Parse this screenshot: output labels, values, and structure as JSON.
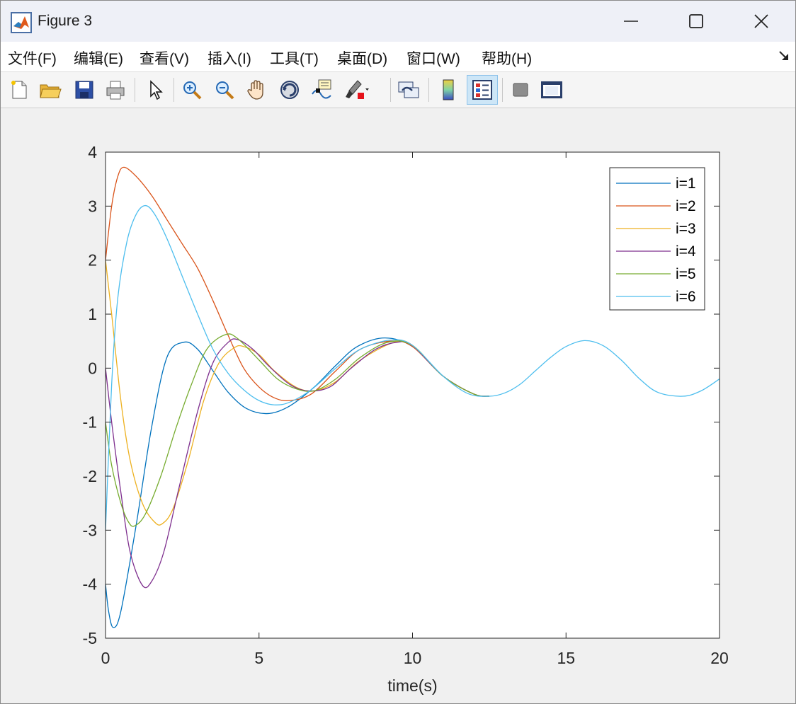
{
  "window": {
    "title": "Figure 3",
    "icon": "matlab-icon",
    "controls": [
      "minimize-icon",
      "maximize-icon",
      "close-icon"
    ]
  },
  "menu": {
    "items": [
      "文件(F)",
      "编辑(E)",
      "查看(V)",
      "插入(I)",
      "工具(T)",
      "桌面(D)",
      "窗口(W)",
      "帮助(H)"
    ]
  },
  "toolbar": {
    "buttons": [
      {
        "icon": "new-figure-icon"
      },
      {
        "icon": "open-file-icon"
      },
      {
        "icon": "save-icon"
      },
      {
        "icon": "print-icon"
      },
      {
        "icon": "edit-plot-arrow-icon"
      },
      {
        "icon": "zoom-in-icon"
      },
      {
        "icon": "zoom-out-icon"
      },
      {
        "icon": "pan-hand-icon"
      },
      {
        "icon": "rotate-3d-icon"
      },
      {
        "icon": "data-cursor-icon"
      },
      {
        "icon": "brush-icon"
      },
      {
        "icon": "link-plot-icon"
      },
      {
        "icon": "colorbar-icon"
      },
      {
        "icon": "legend-icon",
        "active": true
      },
      {
        "icon": "hide-plot-tools-icon"
      },
      {
        "icon": "show-plot-tools-icon"
      }
    ]
  },
  "chart_data": {
    "type": "line",
    "xlabel": "time(s)",
    "ylabel": "",
    "title": "",
    "xlim": [
      0,
      20
    ],
    "ylim": [
      -5,
      4
    ],
    "xticks": [
      "0",
      "5",
      "10",
      "15",
      "20"
    ],
    "yticks": [
      "4",
      "3",
      "2",
      "1",
      "0",
      "-1",
      "-2",
      "-3",
      "-4",
      "-5"
    ],
    "grid": false,
    "legend_position": "top-right",
    "series": [
      {
        "name": "i=1",
        "color": "#0072BD",
        "points": [
          [
            0,
            -4
          ],
          [
            0.1,
            -4.5
          ],
          [
            0.25,
            -4.8
          ],
          [
            0.5,
            -4.5
          ],
          [
            1.0,
            -2.9
          ],
          [
            1.5,
            -1.1
          ],
          [
            2.0,
            0.2
          ],
          [
            2.55,
            0.48
          ],
          [
            3.0,
            0.35
          ],
          [
            3.5,
            -0.05
          ],
          [
            4.0,
            -0.45
          ],
          [
            4.6,
            -0.75
          ],
          [
            5.3,
            -0.84
          ],
          [
            6.0,
            -0.7
          ],
          [
            6.8,
            -0.35
          ],
          [
            7.5,
            0.05
          ],
          [
            8.2,
            0.4
          ],
          [
            9.1,
            0.56
          ],
          [
            10.0,
            0.4
          ],
          [
            11.0,
            -0.15
          ],
          [
            12.0,
            -0.48
          ],
          [
            12.5,
            -0.52
          ]
        ]
      },
      {
        "name": "i=2",
        "color": "#D95319",
        "points": [
          [
            0,
            2
          ],
          [
            0.2,
            3.0
          ],
          [
            0.4,
            3.55
          ],
          [
            0.6,
            3.72
          ],
          [
            1.0,
            3.55
          ],
          [
            1.5,
            3.2
          ],
          [
            2.0,
            2.75
          ],
          [
            2.5,
            2.3
          ],
          [
            3.0,
            1.85
          ],
          [
            3.5,
            1.25
          ],
          [
            4.0,
            0.6
          ],
          [
            4.5,
            0.0
          ],
          [
            5.0,
            -0.35
          ],
          [
            5.5,
            -0.55
          ],
          [
            6.0,
            -0.6
          ],
          [
            6.7,
            -0.48
          ],
          [
            7.5,
            -0.05
          ],
          [
            8.3,
            0.35
          ],
          [
            9.3,
            0.5
          ],
          [
            10.0,
            0.4
          ],
          [
            11.0,
            -0.15
          ],
          [
            12.0,
            -0.48
          ],
          [
            12.5,
            -0.52
          ]
        ]
      },
      {
        "name": "i=3",
        "color": "#EDB120",
        "points": [
          [
            0,
            2
          ],
          [
            0.2,
            1.0
          ],
          [
            0.5,
            -0.6
          ],
          [
            0.8,
            -1.7
          ],
          [
            1.2,
            -2.5
          ],
          [
            1.6,
            -2.85
          ],
          [
            1.85,
            -2.88
          ],
          [
            2.2,
            -2.6
          ],
          [
            2.7,
            -1.7
          ],
          [
            3.2,
            -0.6
          ],
          [
            3.7,
            0.1
          ],
          [
            4.2,
            0.38
          ],
          [
            4.5,
            0.4
          ],
          [
            5.0,
            0.25
          ],
          [
            5.5,
            -0.05
          ],
          [
            6.2,
            -0.35
          ],
          [
            6.8,
            -0.42
          ],
          [
            7.5,
            -0.25
          ],
          [
            8.3,
            0.15
          ],
          [
            9.4,
            0.48
          ],
          [
            10.0,
            0.42
          ],
          [
            11.0,
            -0.15
          ],
          [
            12.0,
            -0.48
          ],
          [
            12.5,
            -0.52
          ]
        ]
      },
      {
        "name": "i=4",
        "color": "#7E2F8E",
        "points": [
          [
            0,
            0
          ],
          [
            0.2,
            -1.0
          ],
          [
            0.5,
            -2.3
          ],
          [
            0.8,
            -3.4
          ],
          [
            1.2,
            -4.02
          ],
          [
            1.5,
            -3.95
          ],
          [
            1.9,
            -3.4
          ],
          [
            2.4,
            -2.2
          ],
          [
            3.0,
            -0.8
          ],
          [
            3.5,
            0.1
          ],
          [
            4.0,
            0.48
          ],
          [
            4.3,
            0.53
          ],
          [
            4.8,
            0.35
          ],
          [
            5.3,
            0.05
          ],
          [
            6.0,
            -0.3
          ],
          [
            6.6,
            -0.42
          ],
          [
            7.3,
            -0.35
          ],
          [
            8.0,
            0.0
          ],
          [
            8.8,
            0.35
          ],
          [
            9.5,
            0.48
          ],
          [
            10.0,
            0.42
          ],
          [
            11.0,
            -0.15
          ],
          [
            12.0,
            -0.48
          ],
          [
            12.5,
            -0.52
          ]
        ]
      },
      {
        "name": "i=5",
        "color": "#77AC30",
        "points": [
          [
            0,
            -1
          ],
          [
            0.2,
            -1.8
          ],
          [
            0.5,
            -2.5
          ],
          [
            0.75,
            -2.85
          ],
          [
            0.95,
            -2.92
          ],
          [
            1.3,
            -2.7
          ],
          [
            1.8,
            -2.0
          ],
          [
            2.3,
            -1.1
          ],
          [
            2.8,
            -0.3
          ],
          [
            3.3,
            0.35
          ],
          [
            3.9,
            0.62
          ],
          [
            4.3,
            0.55
          ],
          [
            5.0,
            0.15
          ],
          [
            5.6,
            -0.2
          ],
          [
            6.2,
            -0.38
          ],
          [
            6.8,
            -0.42
          ],
          [
            7.5,
            -0.2
          ],
          [
            8.3,
            0.2
          ],
          [
            9.2,
            0.48
          ],
          [
            10.0,
            0.42
          ],
          [
            11.0,
            -0.15
          ],
          [
            12.0,
            -0.48
          ],
          [
            12.5,
            -0.52
          ]
        ]
      },
      {
        "name": "i=6",
        "color": "#4DBEEE",
        "points": [
          [
            0,
            -3
          ],
          [
            0.2,
            -0.3
          ],
          [
            0.4,
            1.3
          ],
          [
            0.7,
            2.35
          ],
          [
            1.0,
            2.85
          ],
          [
            1.3,
            3.01
          ],
          [
            1.6,
            2.85
          ],
          [
            2.0,
            2.4
          ],
          [
            2.5,
            1.7
          ],
          [
            3.0,
            1.0
          ],
          [
            3.5,
            0.35
          ],
          [
            4.0,
            -0.1
          ],
          [
            4.5,
            -0.4
          ],
          [
            5.0,
            -0.6
          ],
          [
            5.5,
            -0.68
          ],
          [
            6.0,
            -0.63
          ],
          [
            6.7,
            -0.4
          ],
          [
            7.5,
            0.0
          ],
          [
            8.3,
            0.35
          ],
          [
            9.3,
            0.52
          ],
          [
            10.0,
            0.42
          ],
          [
            11.0,
            -0.15
          ],
          [
            11.8,
            -0.47
          ],
          [
            12.5,
            -0.52
          ],
          [
            13.0,
            -0.46
          ],
          [
            13.5,
            -0.3
          ],
          [
            14.0,
            -0.05
          ],
          [
            14.5,
            0.2
          ],
          [
            15.0,
            0.4
          ],
          [
            15.6,
            0.51
          ],
          [
            16.2,
            0.42
          ],
          [
            16.8,
            0.15
          ],
          [
            17.4,
            -0.2
          ],
          [
            18.0,
            -0.45
          ],
          [
            18.8,
            -0.52
          ],
          [
            19.4,
            -0.42
          ],
          [
            20.0,
            -0.2
          ]
        ]
      }
    ]
  }
}
